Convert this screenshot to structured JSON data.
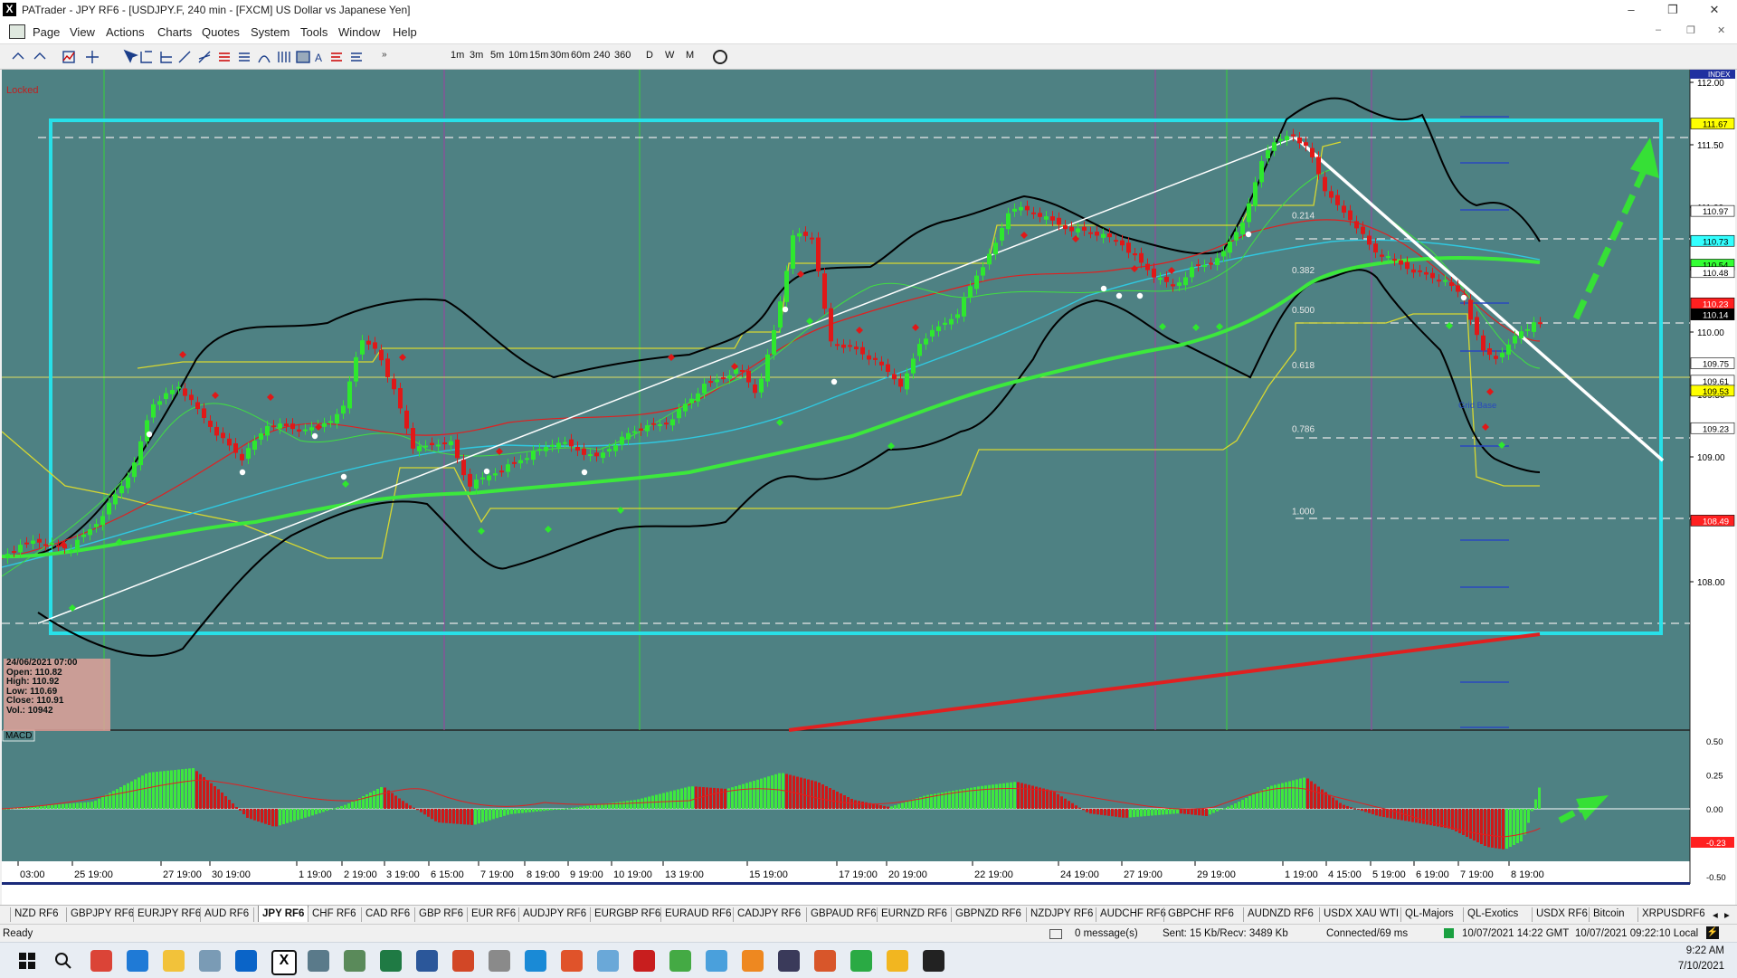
{
  "window": {
    "title": "PATrader - JPY RF6 - [USDJPY.F, 240 min - [FXCM] US Dollar vs Japanese Yen]",
    "controls": [
      "–",
      "❐",
      "✕"
    ]
  },
  "menu": [
    "Page",
    "View",
    "Actions",
    "Charts",
    "Quotes",
    "System",
    "Tools",
    "Window",
    "Help"
  ],
  "toolbar": {
    "timeframes": [
      "1m",
      "3m",
      "5m",
      "10m",
      "15m",
      "30m",
      "60m",
      "240",
      "360",
      "D",
      "W",
      "M"
    ]
  },
  "chart": {
    "locked_label": "Locked",
    "index_label": "INDEX",
    "macd_label": "MACD",
    "price_axis": [
      "112.00",
      "111.50",
      "111.00",
      "110.50",
      "110.00",
      "109.50",
      "109.00",
      "108.50",
      "108.00"
    ],
    "price_tags": [
      {
        "text": "111.67",
        "color": "#ffff00",
        "price": 111.67
      },
      {
        "text": "110.97",
        "color": "#ffffff",
        "price": 110.97
      },
      {
        "text": "110.73",
        "color": "#33ffff",
        "price": 110.73
      },
      {
        "text": "110.54",
        "color": "#33ff33",
        "price": 110.54
      },
      {
        "text": "110.48",
        "color": "#ffffff",
        "price": 110.48
      },
      {
        "text": "110.23",
        "color": "#ff2020",
        "price": 110.23
      },
      {
        "text": "110.14",
        "color": "#000000",
        "price": 110.14
      },
      {
        "text": "109.75",
        "color": "#ffffff",
        "price": 109.75
      },
      {
        "text": "109.61",
        "color": "#ffffff",
        "price": 109.61
      },
      {
        "text": "109.53",
        "color": "#ffff00",
        "price": 109.53
      },
      {
        "text": "109.23",
        "color": "#ffffff",
        "price": 109.23
      },
      {
        "text": "108.49",
        "color": "#ff2020",
        "price": 108.49
      }
    ],
    "macd_axis": [
      "0.50",
      "0.25",
      "0.00",
      "-0.25",
      "-0.50"
    ],
    "macd_tag": "-0.23",
    "fib_levels": [
      {
        "label": "0.214",
        "price": 110.94
      },
      {
        "label": "0.382",
        "price": 110.5
      },
      {
        "label": "0.500",
        "price": 110.18
      },
      {
        "label": "0.618",
        "price": 109.74
      },
      {
        "label": "0.786",
        "price": 109.23
      },
      {
        "label": "1.000",
        "price": 108.57
      }
    ],
    "base_label": "Grid Base",
    "time_axis": [
      "03:00",
      "25 19:00",
      "27 19:00",
      "30 19:00",
      "1 19:00",
      "2 19:00",
      "3 19:00",
      "6 15:00",
      "7 19:00",
      "8 19:00",
      "9 19:00",
      "10 19:00",
      "13 19:00",
      "15 19:00",
      "17 19:00",
      "20 19:00",
      "22 19:00",
      "24 19:00",
      "27 19:00",
      "29 19:00",
      "1 19:00",
      "4 15:00",
      "5 19:00",
      "6 19:00",
      "7 19:00",
      "8 19:00"
    ],
    "info": {
      "date": "24/06/2021 07:00",
      "open": "Open: 110.82",
      "high": "High: 110.92",
      "low": "Low: 110.69",
      "close": "Close: 110.91",
      "vol": "Vol.: 10942"
    }
  },
  "symbol_tabs": [
    "NZD RF6",
    "GBPJPY RF6",
    "EURJPY RF6",
    "AUD RF6",
    "JPY RF6",
    "CHF RF6",
    "CAD RF6",
    "GBP RF6",
    "EUR RF6",
    "AUDJPY RF6",
    "EURGBP RF6",
    "EURAUD RF6",
    "CADJPY RF6",
    "GBPAUD RF6",
    "EURNZD RF6",
    "GBPNZD RF6",
    "NZDJPY RF6",
    "AUDCHF RF6",
    "GBPCHF RF6",
    "AUDNZD RF6",
    "USDX XAU WTI",
    "QL-Majors",
    "QL-Exotics",
    "USDX RF6",
    "Bitcoin",
    "XRPUSDRF6"
  ],
  "active_tab": "JPY RF6",
  "status": {
    "ready": "Ready",
    "messages": "0 message(s)",
    "traffic": "Sent: 15 Kb/Recv: 3489 Kb",
    "connection": "Connected/69 ms",
    "server_time": "10/07/2021 14:22 GMT",
    "local_time": "10/07/2021 09:22:10 Local"
  },
  "taskbar": {
    "time": "9:22 AM",
    "date": "7/10/2021",
    "apps": [
      "windows-icon",
      "search-icon",
      "chrome-icon",
      "edge-icon",
      "folder-icon",
      "app-icon",
      "outlook-icon",
      "patrader-icon",
      "calculator-icon",
      "app-icon",
      "excel-icon",
      "word-icon",
      "powerpoint-icon",
      "app-icon",
      "app-icon",
      "app-icon",
      "app-icon",
      "app-icon",
      "app-icon",
      "app-icon",
      "app-icon",
      "app-icon",
      "app-icon",
      "app-icon",
      "app-icon",
      "app-icon"
    ]
  }
}
